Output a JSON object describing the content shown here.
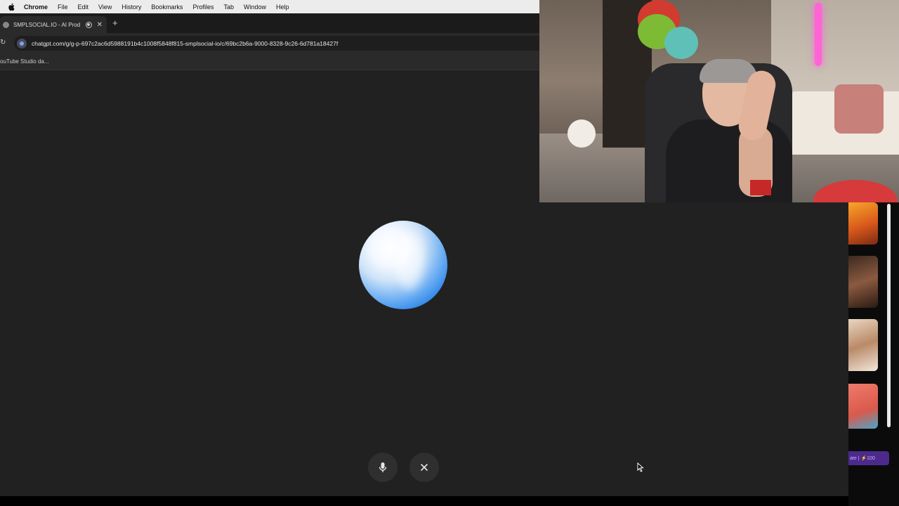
{
  "menubar": {
    "app": "Chrome",
    "items": [
      "File",
      "Edit",
      "View",
      "History",
      "Bookmarks",
      "Profiles",
      "Tab",
      "Window",
      "Help"
    ]
  },
  "tab": {
    "title": "SMPLSOCIAL.IO - AI Prod"
  },
  "address_bar": {
    "url": "chatgpt.com/g/g-p-697c2ac6d5988191b4c1008f5848f815-smplsocial-io/c/69bc2b6a-9000-8328-9c26-6d781a18427f"
  },
  "bookmarks": {
    "item": "ouTube Studio da..."
  },
  "voice": {
    "mic_label": "",
    "close_label": ""
  },
  "side": {
    "create_label": "ate | ⚡100"
  },
  "colors": {
    "orb_blue": "#2f86ea",
    "page_bg": "#212121",
    "create_button": "#4b2a8c"
  }
}
